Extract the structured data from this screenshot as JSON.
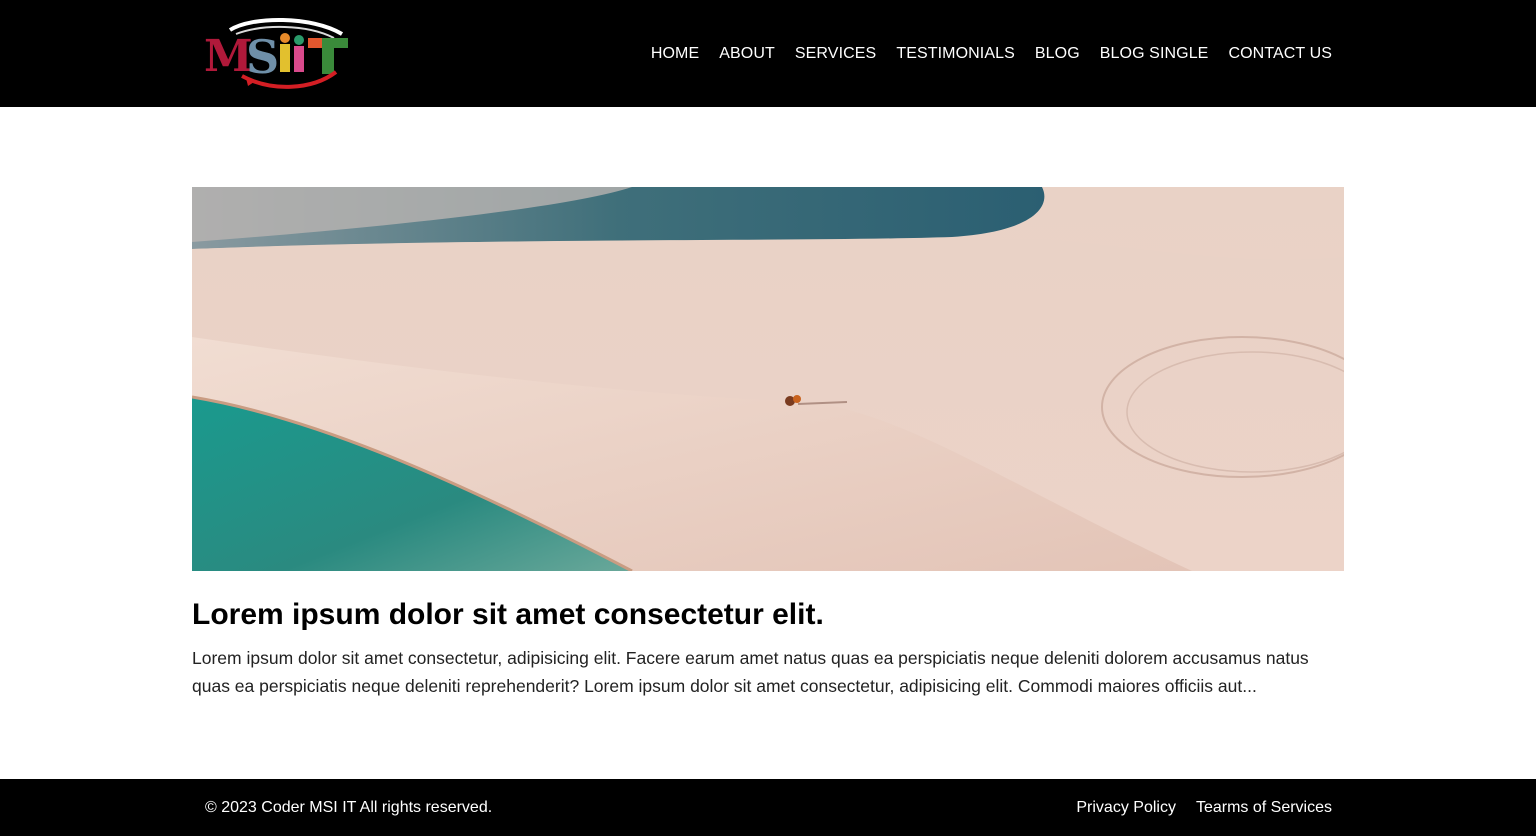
{
  "brand": {
    "logo_text": "MSIIT"
  },
  "nav": {
    "items": [
      {
        "label": "HOME"
      },
      {
        "label": "ABOUT"
      },
      {
        "label": "SERVICES"
      },
      {
        "label": "TESTIMONIALS"
      },
      {
        "label": "BLOG"
      },
      {
        "label": "BLOG SINGLE"
      },
      {
        "label": "CONTACT US"
      }
    ]
  },
  "post": {
    "title": "Lorem ipsum dolor sit amet consectetur elit.",
    "excerpt": "Lorem ipsum dolor sit amet consectetur, adipisicing elit. Facere earum amet natus quas ea perspiciatis neque deleniti dolorem accusamus natus quas ea perspiciatis neque deleniti reprehenderit? Lorem ipsum dolor sit amet consectetur, adipisicing elit. Commodi maiores officiis aut..."
  },
  "footer": {
    "copyright": "© 2023 Coder MSI IT All rights reserved.",
    "links": [
      {
        "label": "Privacy Policy"
      },
      {
        "label": "Tearms of Services"
      }
    ]
  },
  "colors": {
    "header_bg": "#000000",
    "footer_bg": "#000000",
    "text_light": "#ffffff",
    "sand": "#e8c9bc",
    "lagoon": "#1f8f86"
  }
}
